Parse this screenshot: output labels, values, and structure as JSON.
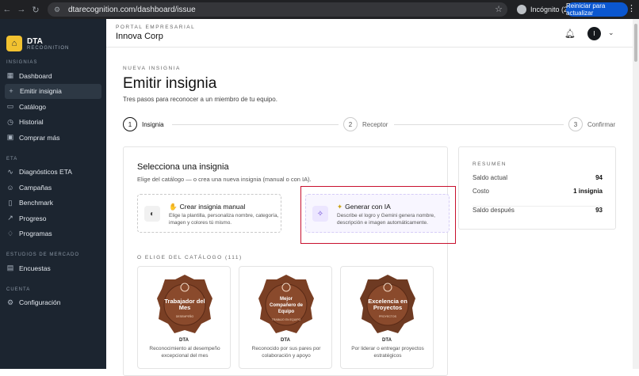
{
  "browser": {
    "url": "dtarecognition.com/dashboard/issue",
    "incognito_label": "Incógnito (2)",
    "update_label": "Reiniciar para actualizar"
  },
  "brand": {
    "name": "DTA",
    "sub": "RECOGNITION",
    "logo_glyph": "⌂"
  },
  "sidebar": {
    "sections": [
      {
        "label": "INSIGNIAS",
        "items": [
          {
            "label": "Dashboard",
            "icon": "grid-icon",
            "glyph": "▦",
            "active": false
          },
          {
            "label": "Emitir insignia",
            "icon": "plus-icon",
            "glyph": "+",
            "active": true
          },
          {
            "label": "Catálogo",
            "icon": "book-icon",
            "glyph": "▭",
            "active": false
          },
          {
            "label": "Historial",
            "icon": "clock-icon",
            "glyph": "◷",
            "active": false
          },
          {
            "label": "Comprar más",
            "icon": "cart-icon",
            "glyph": "▣",
            "active": false
          }
        ]
      },
      {
        "label": "ETA",
        "items": [
          {
            "label": "Diagnósticos ETA",
            "icon": "chart-icon",
            "glyph": "∿",
            "active": false
          },
          {
            "label": "Campañas",
            "icon": "users-icon",
            "glyph": "☺",
            "active": false
          },
          {
            "label": "Benchmark",
            "icon": "benchmark-icon",
            "glyph": "▯",
            "active": false
          },
          {
            "label": "Progreso",
            "icon": "progress-icon",
            "glyph": "↗",
            "active": false
          },
          {
            "label": "Programas",
            "icon": "lightbulb-icon",
            "glyph": "♢",
            "active": false
          }
        ]
      },
      {
        "label": "ESTUDIOS DE MERCADO",
        "items": [
          {
            "label": "Encuestas",
            "icon": "survey-icon",
            "glyph": "▤",
            "active": false
          }
        ]
      },
      {
        "label": "CUENTA",
        "items": [
          {
            "label": "Configuración",
            "icon": "gear-icon",
            "glyph": "⚙",
            "active": false
          }
        ]
      }
    ]
  },
  "header": {
    "portal_label": "PORTAL EMPRESARIAL",
    "company": "Innova Corp",
    "avatar_initial": "I"
  },
  "page": {
    "eyebrow": "NUEVA INSIGNIA",
    "title": "Emitir insignia",
    "subtitle": "Tres pasos para reconocer a un miembro de tu equipo."
  },
  "steps": [
    {
      "num": "1",
      "label": "Insignia",
      "active": true
    },
    {
      "num": "2",
      "label": "Receptor",
      "active": false
    },
    {
      "num": "3",
      "label": "Confirmar",
      "active": false
    }
  ],
  "select_card": {
    "title": "Selecciona una insignia",
    "subtitle": "Elige del catálogo — o crea una nueva insignia (manual o con IA).",
    "manual": {
      "title": "Crear insignia manual",
      "title_glyph": "✋",
      "desc": "Elige la plantilla, personaliza nombre, categoría, imagen y colores tú mismo."
    },
    "ai": {
      "title": "Generar con IA",
      "title_glyph": "✦",
      "desc": "Describe el logro y Gemini genera nombre, descripción e imagen automáticamente."
    },
    "catalog_label": "O ELIGE DEL CATÁLOGO (111)",
    "badges": [
      {
        "name_lines": [
          "Trabajador del",
          "Mes"
        ],
        "tag": "DESEMPEÑO",
        "org": "DTA",
        "desc": "Reconocimiento al desempeño excepcional del mes",
        "color": "#7a3f24"
      },
      {
        "name_lines": [
          "Mejor",
          "Compañero de",
          "Equipo"
        ],
        "tag": "TRABAJO EN EQUIPO",
        "org": "DTA",
        "desc": "Reconocido por sus pares por colaboración y apoyo",
        "color": "#7a3f24"
      },
      {
        "name_lines": [
          "Excelencia en",
          "Proyectos"
        ],
        "tag": "PROYECTOS",
        "org": "DTA",
        "desc": "Por liderar o entregar proyectos estratégicos",
        "color": "#6e3a22"
      }
    ]
  },
  "summary": {
    "label": "RESUMEN",
    "rows": [
      {
        "label": "Saldo actual",
        "value": "94"
      },
      {
        "label": "Costo",
        "value": "1 insignia"
      },
      {
        "label": "Saldo después",
        "value": "93"
      }
    ]
  }
}
